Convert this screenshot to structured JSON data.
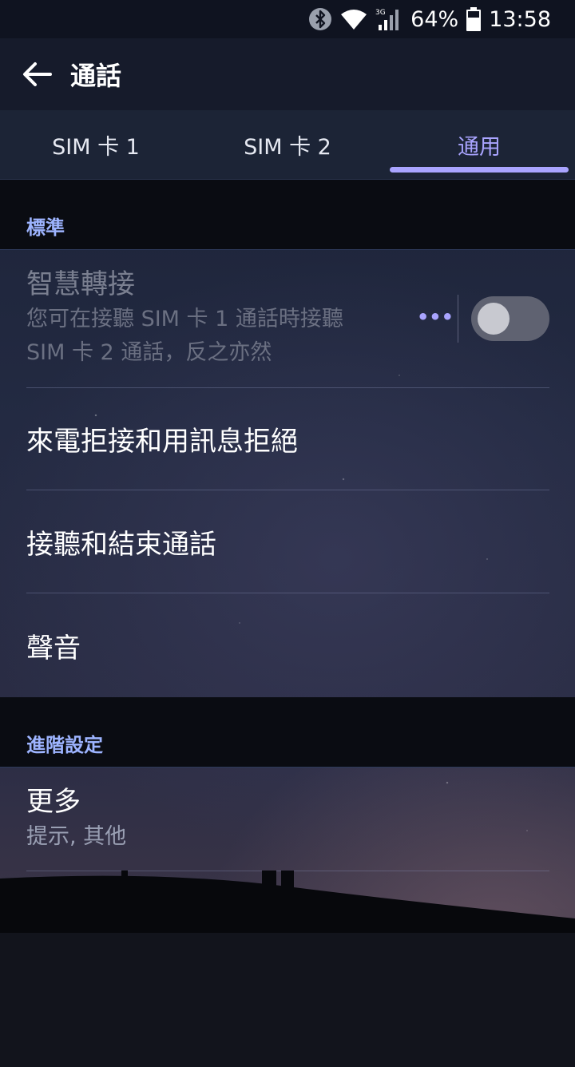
{
  "status_bar": {
    "bluetooth_icon": "bluetooth-icon",
    "wifi_icon": "wifi-icon",
    "network_type": "3G",
    "battery_percent": "64%",
    "time": "13:58"
  },
  "app_bar": {
    "back_icon": "arrow-left-icon",
    "title": "通話"
  },
  "tabs": [
    {
      "label": "SIM 卡 1",
      "active": false
    },
    {
      "label": "SIM 卡 2",
      "active": false
    },
    {
      "label": "通用",
      "active": true
    }
  ],
  "sections": {
    "standard": {
      "header": "標準",
      "smart_forward": {
        "title": "智慧轉接",
        "subtitle_line1": "您可在接聽 SIM 卡 1 通話時接聽",
        "subtitle_line2": "SIM 卡 2 通話，反之亦然",
        "more_label": "•••",
        "toggle_on": false
      },
      "reject_with_message": {
        "title": "來電拒接和用訊息拒絕"
      },
      "answer_end_call": {
        "title": "接聽和結束通話"
      },
      "sound": {
        "title": "聲音"
      }
    },
    "advanced": {
      "header": "進階設定",
      "more": {
        "title": "更多",
        "subtitle": "提示, 其他"
      }
    }
  },
  "colors": {
    "accent": "#a9a4ff",
    "section_header": "#9db4ff",
    "status_bar_bg": "#0f1320",
    "app_bar_bg": "#161b2b",
    "tabs_bg": "#1c2436"
  }
}
